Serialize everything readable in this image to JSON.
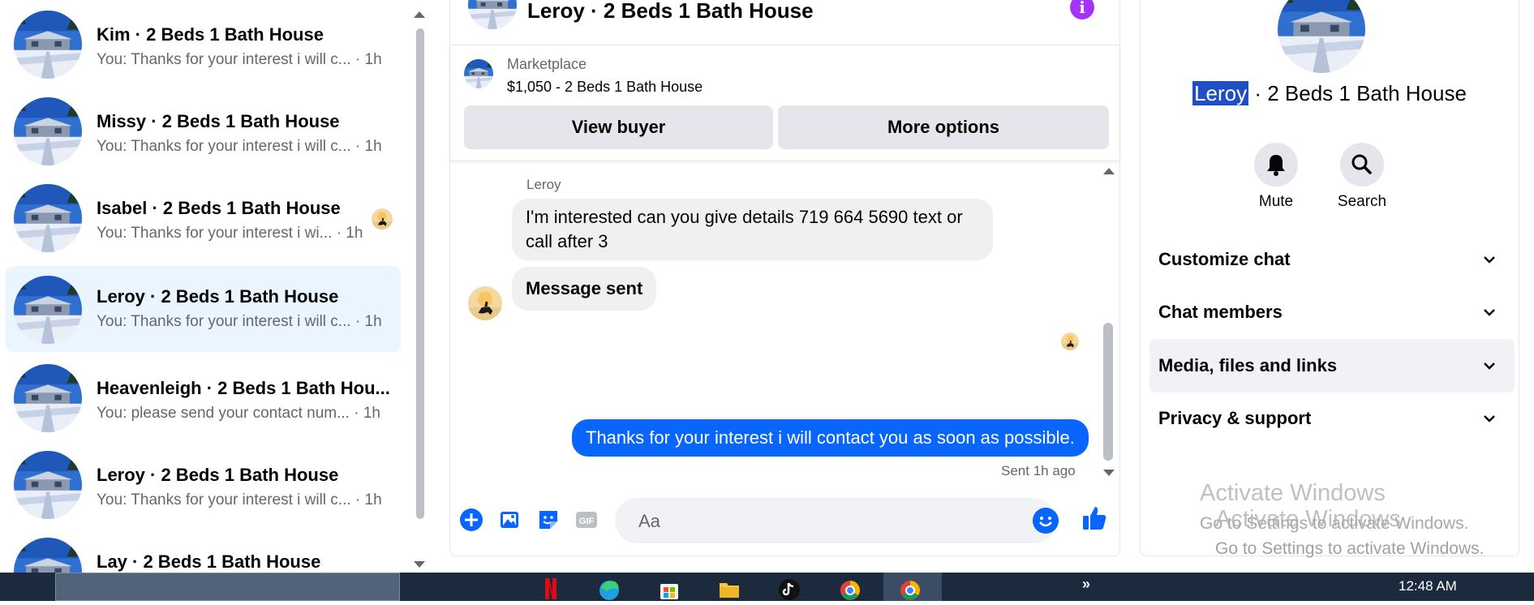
{
  "chat_list": [
    {
      "title": "Kim · 2 Beds 1 Bath House",
      "preview": "You: Thanks for your interest i will c... · 1h",
      "active": false
    },
    {
      "title": "Missy · 2 Beds 1 Bath House",
      "preview": "You: Thanks for your interest i will c... · 1h",
      "active": false
    },
    {
      "title": "Isabel · 2 Beds 1 Bath House",
      "preview": "You: Thanks for your interest i wi... · 1h",
      "active": false
    },
    {
      "title": "Leroy · 2 Beds 1 Bath House",
      "preview": "You: Thanks for your interest i will c... · 1h",
      "active": true
    },
    {
      "title": "Heavenleigh · 2 Beds 1 Bath Hou...",
      "preview": "You: please send your contact num... · 1h",
      "active": false
    },
    {
      "title": "Leroy · 2 Beds 1 Bath House",
      "preview": "You: Thanks for your interest i will c... · 1h",
      "active": false
    },
    {
      "title": "Lay · 2 Beds 1 Bath House",
      "preview": "",
      "active": false
    }
  ],
  "conversation": {
    "title": "Leroy · 2 Beds 1 Bath House",
    "marketplace_label": "Marketplace",
    "listing_price_title": "$1,050 - 2 Beds 1 Bath House",
    "view_buyer_label": "View buyer",
    "more_options_label": "More options",
    "sender_name": "Leroy",
    "incoming_message": "I'm interested can you give details 719 664 5690  text or call after 3",
    "incoming_status": "Message sent",
    "outgoing_message": "Thanks for your interest i will contact you as soon as possible.",
    "sent_status": "Sent 1h ago",
    "composer_placeholder": "Aa"
  },
  "details": {
    "title_highlight": "Leroy",
    "title_rest": " · 2 Beds 1 Bath House",
    "mute_label": "Mute",
    "search_label": "Search",
    "sections": [
      "Customize chat",
      "Chat members",
      "Media, files and links",
      "Privacy & support"
    ]
  },
  "watermark": {
    "line1": "Activate Windows",
    "line2": "Go to Settings to activate Windows."
  },
  "taskbar": {
    "clock": "12:48 AM",
    "overflow": "»"
  },
  "colors": {
    "accent_blue": "#0866ff",
    "info_purple": "#a334fa",
    "active_chat_bg": "#ebf5ff",
    "taskbar_bg": "#1c2a3e"
  },
  "icons": [
    "plus-circle-icon",
    "photo-icon",
    "sticker-icon",
    "gif-icon",
    "emoji-icon",
    "thumbs-up-icon",
    "bell-icon",
    "search-icon",
    "chevron-down-icon",
    "info-icon"
  ]
}
